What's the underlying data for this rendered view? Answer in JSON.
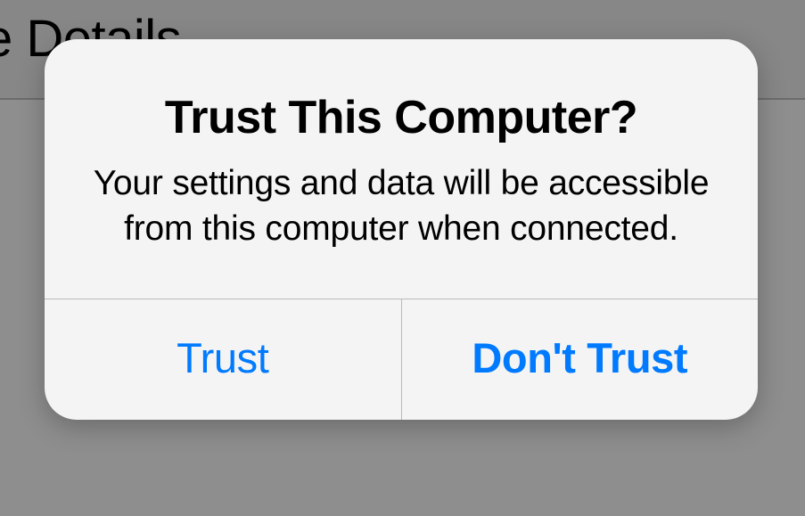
{
  "background": {
    "partial_text": "e Details"
  },
  "dialog": {
    "title": "Trust This Computer?",
    "message": "Your settings and data will be accessible from this computer when connected.",
    "buttons": {
      "trust": "Trust",
      "dont_trust": "Don't Trust"
    }
  }
}
